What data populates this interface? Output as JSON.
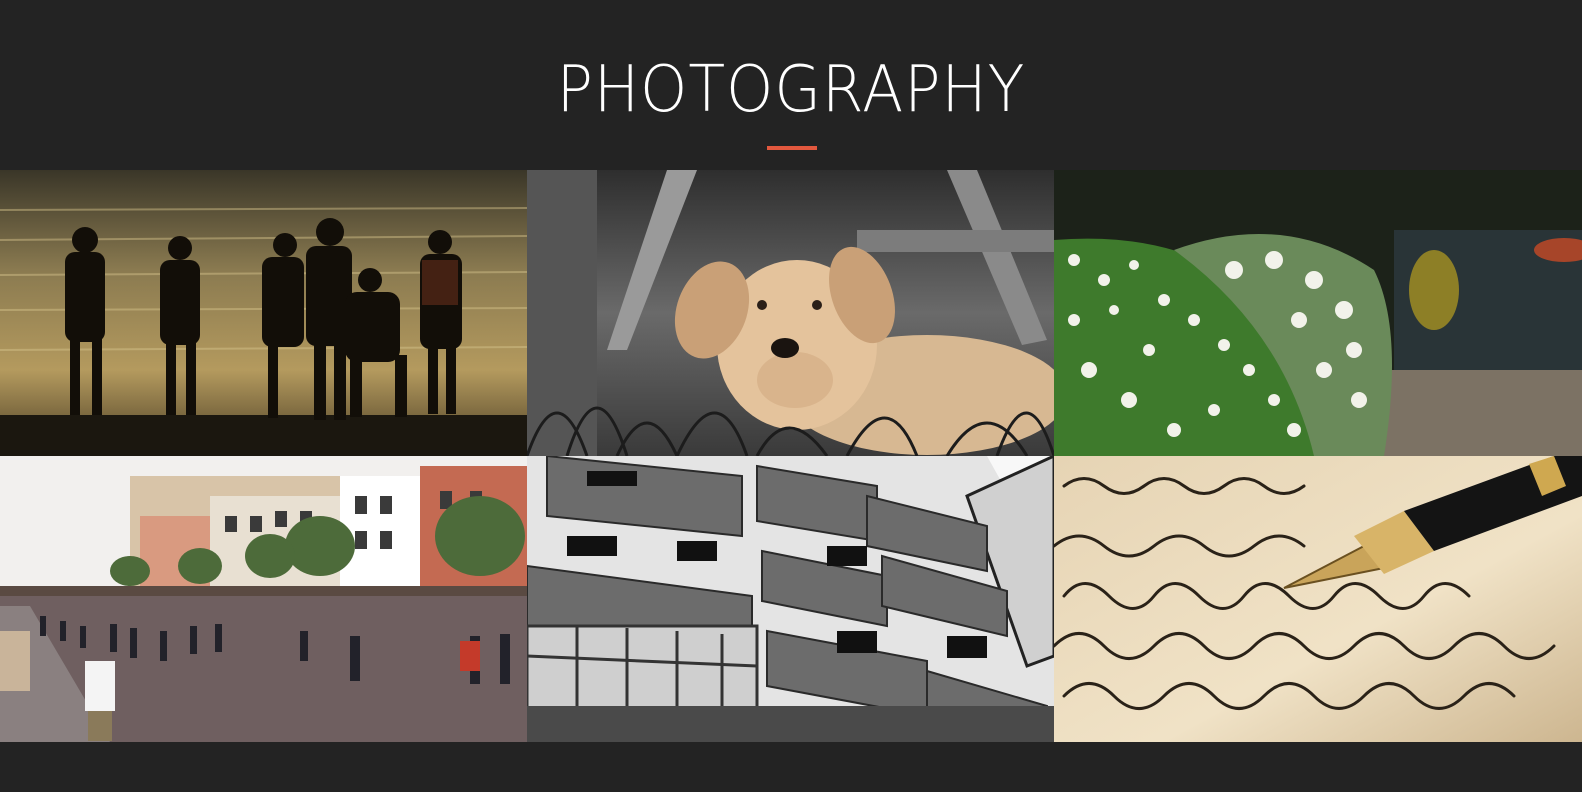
{
  "header": {
    "title": "PHOTOGRAPHY"
  },
  "colors": {
    "background": "#232323",
    "accent": "#e2583e",
    "title": "#ffffff"
  },
  "gallery": {
    "photos": [
      {
        "name": "beach-silhouettes"
      },
      {
        "name": "puppy"
      },
      {
        "name": "daisies"
      },
      {
        "name": "street-crowd"
      },
      {
        "name": "building-facade"
      },
      {
        "name": "fountain-pen"
      }
    ]
  }
}
